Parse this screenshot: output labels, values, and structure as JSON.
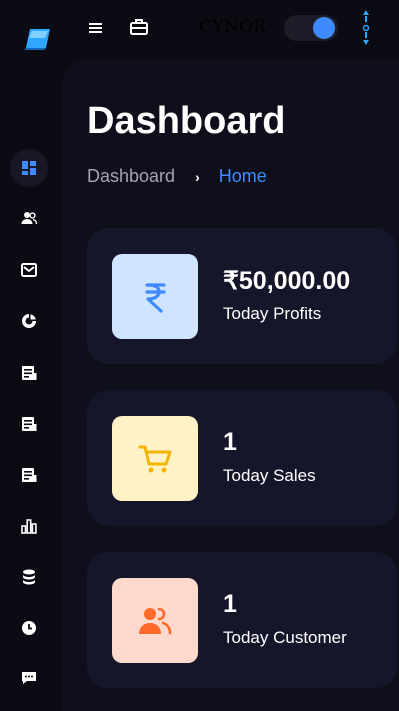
{
  "header": {
    "brand": "CYNOR",
    "theme_toggle_on": true
  },
  "page": {
    "title": "Dashboard",
    "breadcrumb": {
      "parent": "Dashboard",
      "current": "Home"
    }
  },
  "sidebar": {
    "items": [
      {
        "icon": "dashboard-icon",
        "active": true
      },
      {
        "icon": "users-icon"
      },
      {
        "icon": "mail-icon"
      },
      {
        "icon": "chart-ring-icon"
      },
      {
        "icon": "document-icon"
      },
      {
        "icon": "document-icon"
      },
      {
        "icon": "document-icon"
      },
      {
        "icon": "bar-chart-icon"
      },
      {
        "icon": "database-icon"
      },
      {
        "icon": "clock-icon"
      },
      {
        "icon": "chat-icon"
      }
    ]
  },
  "cards": [
    {
      "value": "₹50,000.00",
      "label": "Today Profits",
      "icon": "rupee-icon",
      "bg": "#cfe4ff",
      "fg": "#3d8bff"
    },
    {
      "value": "1",
      "label": "Today Sales",
      "icon": "cart-icon",
      "bg": "#fff2c6",
      "fg": "#f5b400"
    },
    {
      "value": "1",
      "label": "Today Customer",
      "icon": "users-icon",
      "bg": "#ffd9cc",
      "fg": "#ff6a2a"
    }
  ],
  "colors": {
    "accent": "#3d8bff",
    "background": "#0b0b14",
    "panel": "#0f0f1c",
    "card": "#16162a"
  }
}
